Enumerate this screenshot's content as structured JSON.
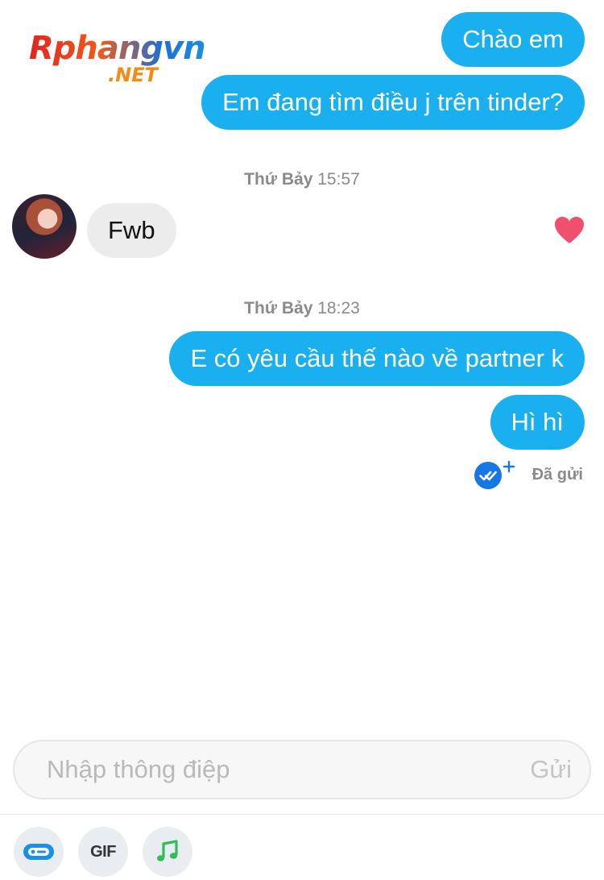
{
  "watermark": {
    "main": "Rphangvn",
    "sub": ".NET"
  },
  "messages": [
    {
      "direction": "out",
      "text": "Chào em"
    },
    {
      "direction": "out",
      "text": "Em đang tìm điều j trên tinder?"
    },
    {
      "direction": "in",
      "text": "Fwb",
      "liked": true
    },
    {
      "direction": "out",
      "text": "E có yêu cầu thế nào về partner k"
    },
    {
      "direction": "out",
      "text": "Hì hì"
    }
  ],
  "timestamps": [
    {
      "day": "Thứ Bảy",
      "time": "15:57"
    },
    {
      "day": "Thứ Bảy",
      "time": "18:23"
    }
  ],
  "status": {
    "text": "Đã gửi"
  },
  "composer": {
    "placeholder": "Nhập thông điệp",
    "send_label": "Gửi"
  },
  "toolbar": {
    "gif_label": "GIF"
  },
  "colors": {
    "outgoing": "#1ab0f0",
    "incoming": "#ececec",
    "heart": "#f0506e",
    "sent_badge": "#1877e6"
  }
}
